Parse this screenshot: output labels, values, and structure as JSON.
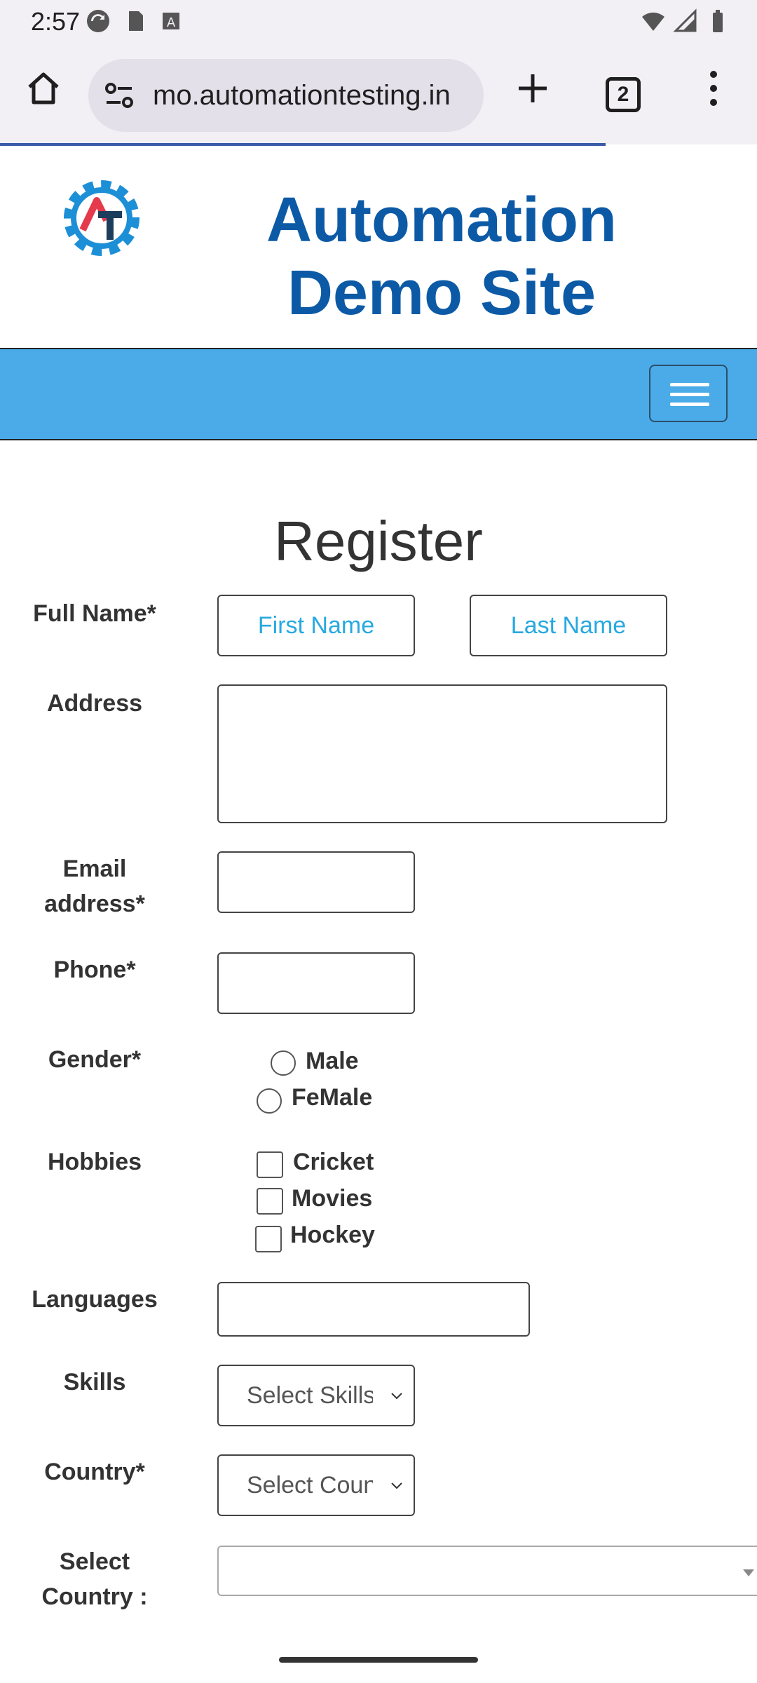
{
  "status_bar": {
    "time": "2:57"
  },
  "browser": {
    "url": "mo.automationtesting.in",
    "tab_count": "2"
  },
  "site": {
    "title_line1": "Automation",
    "title_line2": "Demo Site"
  },
  "form": {
    "heading": "Register",
    "full_name_label": "Full Name*",
    "first_name_placeholder": "First Name",
    "last_name_placeholder": "Last Name",
    "address_label": "Address",
    "email_label_line1": "Email",
    "email_label_line2": "address*",
    "phone_label": "Phone*",
    "gender_label": "Gender*",
    "gender_options": [
      "Male",
      "FeMale"
    ],
    "hobbies_label": "Hobbies",
    "hobbies_options": [
      "Cricket",
      "Movies",
      "Hockey"
    ],
    "languages_label": "Languages",
    "skills_label": "Skills",
    "skills_selected": "Select Skills",
    "country_label": "Country*",
    "country_selected": "Select Country",
    "select_country_label_line1": "Select",
    "select_country_label_line2": "Country :"
  },
  "colors": {
    "navbar": "#4aabe8",
    "title": "#0c5aa6",
    "placeholder": "#27a9e0"
  }
}
